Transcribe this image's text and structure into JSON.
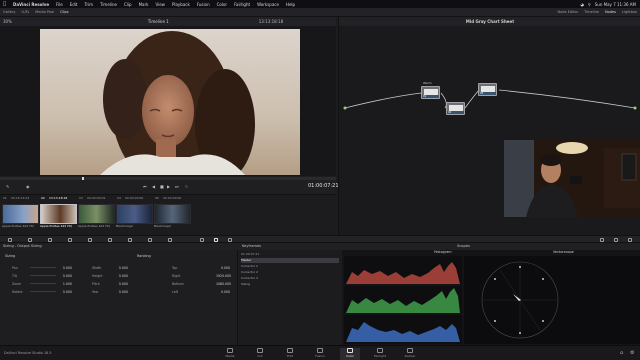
{
  "menubar": {
    "app": "DaVinci Resolve",
    "items": [
      "File",
      "Edit",
      "Trim",
      "Timeline",
      "Clip",
      "Mark",
      "View",
      "Playback",
      "Fusion",
      "Color",
      "Fairlight",
      "Workspace",
      "Help"
    ],
    "clock": "Sun May 7 11:36 AM"
  },
  "toolbar": {
    "items": [
      "Gallery",
      "LUTs",
      "Media Pool",
      "Clips"
    ],
    "right_items": [
      "Node Editor",
      "Timeline",
      "Nodes",
      "Lightbox"
    ]
  },
  "viewer": {
    "zoom": "30%",
    "timeline_name": "Timeline 1",
    "timecode_top": "13:13:18:18",
    "clip_title": "Mid Gray Chart Sheet",
    "timecode": "01:00:07:21"
  },
  "clips": [
    {
      "num": "01",
      "tc": "05:16:14:03",
      "label": "Apple ProRes 422 HQ"
    },
    {
      "num": "02",
      "tc": "13:13:18:18",
      "label": "Apple ProRes 422 HQ"
    },
    {
      "num": "03",
      "tc": "00:00:00:09",
      "label": "Apple ProRes 422 HQ"
    },
    {
      "num": "04",
      "tc": "00:00:00:00",
      "label": "Blackmagic"
    },
    {
      "num": "05",
      "tc": "00:00:00:00",
      "label": "Blackmagic"
    }
  ],
  "nodes": [
    {
      "id": "01",
      "label": "Warm"
    },
    {
      "id": "02",
      "label": ""
    },
    {
      "id": "03",
      "label": ""
    }
  ],
  "panel": {
    "sizing_title": "Sizing - Output Sizing",
    "sizing": "Sizing",
    "ranking": "Ranking",
    "keyframes": "Keyframes",
    "scopes": "Scopes",
    "scope_histogram": "Histogram",
    "scope_vectorscope": "Vectorscope",
    "timecode": "01:00:07:21"
  },
  "sizing_fields": [
    {
      "name": "Pan",
      "value": "0.000"
    },
    {
      "name": "Tilt",
      "value": "0.000"
    },
    {
      "name": "Zoom",
      "value": "1.000"
    },
    {
      "name": "Rotate",
      "value": "0.000"
    },
    {
      "name": "Width",
      "value": "0.000"
    },
    {
      "name": "Height",
      "value": "0.000"
    },
    {
      "name": "Pitch",
      "value": "0.000"
    },
    {
      "name": "Yaw",
      "value": "0.000"
    }
  ],
  "ranking_fields": [
    {
      "name": "Top",
      "value": "0.000"
    },
    {
      "name": "Right",
      "value": "1920.000"
    },
    {
      "name": "Bottom",
      "value": "1080.000"
    },
    {
      "name": "Left",
      "value": "0.000"
    }
  ],
  "keyframe_rows": [
    "Master",
    "Corrector 1",
    "Corrector 2",
    "Corrector 3",
    "Sizing"
  ],
  "pages": [
    "Media",
    "Cut",
    "Edit",
    "Fusion",
    "Color",
    "Fairlight",
    "Deliver"
  ],
  "active_page": "Color",
  "version": "DaVinci Resolve Studio 18.5",
  "colors": {
    "accent": "#e04242",
    "node_link": "#3a5470",
    "panel": "#1e1e21"
  }
}
